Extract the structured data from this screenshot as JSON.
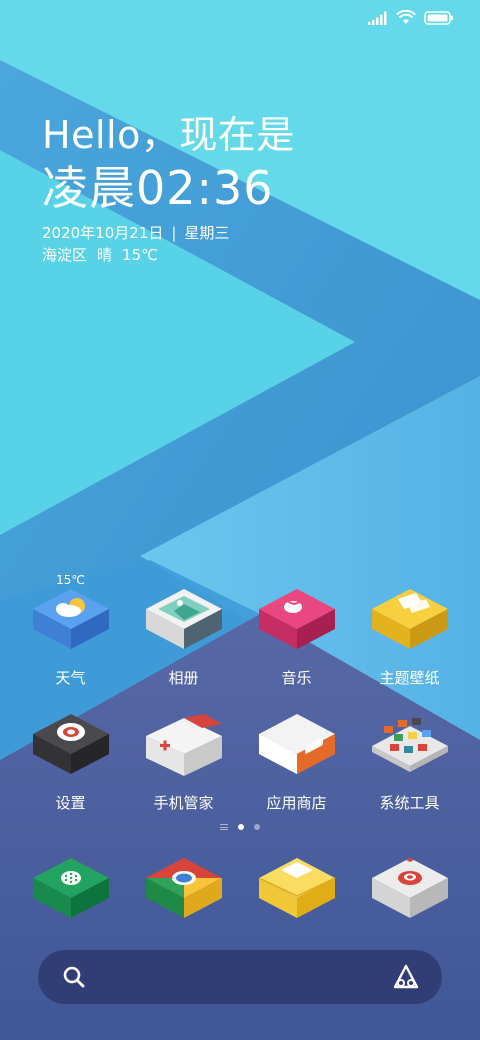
{
  "greeting": {
    "hello": "Hello，现在是",
    "time": "凌晨02:36",
    "date": "2020年10月21日",
    "separator": "|",
    "weekday": "星期三",
    "district": "海淀区",
    "condition": "晴",
    "temperature": "15℃"
  },
  "apps_row1": [
    {
      "label": "天气",
      "icon": "weather-icon",
      "badge": "15℃"
    },
    {
      "label": "相册",
      "icon": "gallery-icon"
    },
    {
      "label": "音乐",
      "icon": "music-icon"
    },
    {
      "label": "主题壁纸",
      "icon": "themes-icon"
    }
  ],
  "apps_row2": [
    {
      "label": "设置",
      "icon": "settings-icon"
    },
    {
      "label": "手机管家",
      "icon": "security-icon"
    },
    {
      "label": "应用商店",
      "icon": "app-store-icon"
    },
    {
      "label": "系统工具",
      "icon": "tools-folder-icon"
    }
  ],
  "dock": [
    {
      "icon": "phone-icon"
    },
    {
      "icon": "browser-icon"
    },
    {
      "icon": "messages-icon"
    },
    {
      "icon": "camera-icon"
    }
  ],
  "pager": {
    "pages": 2,
    "current": 1
  },
  "colors": {
    "sky_top": "#5dd6ea",
    "sky_mid": "#36c4e6",
    "indigo": "#4a5a9c",
    "text": "#ffffff"
  }
}
